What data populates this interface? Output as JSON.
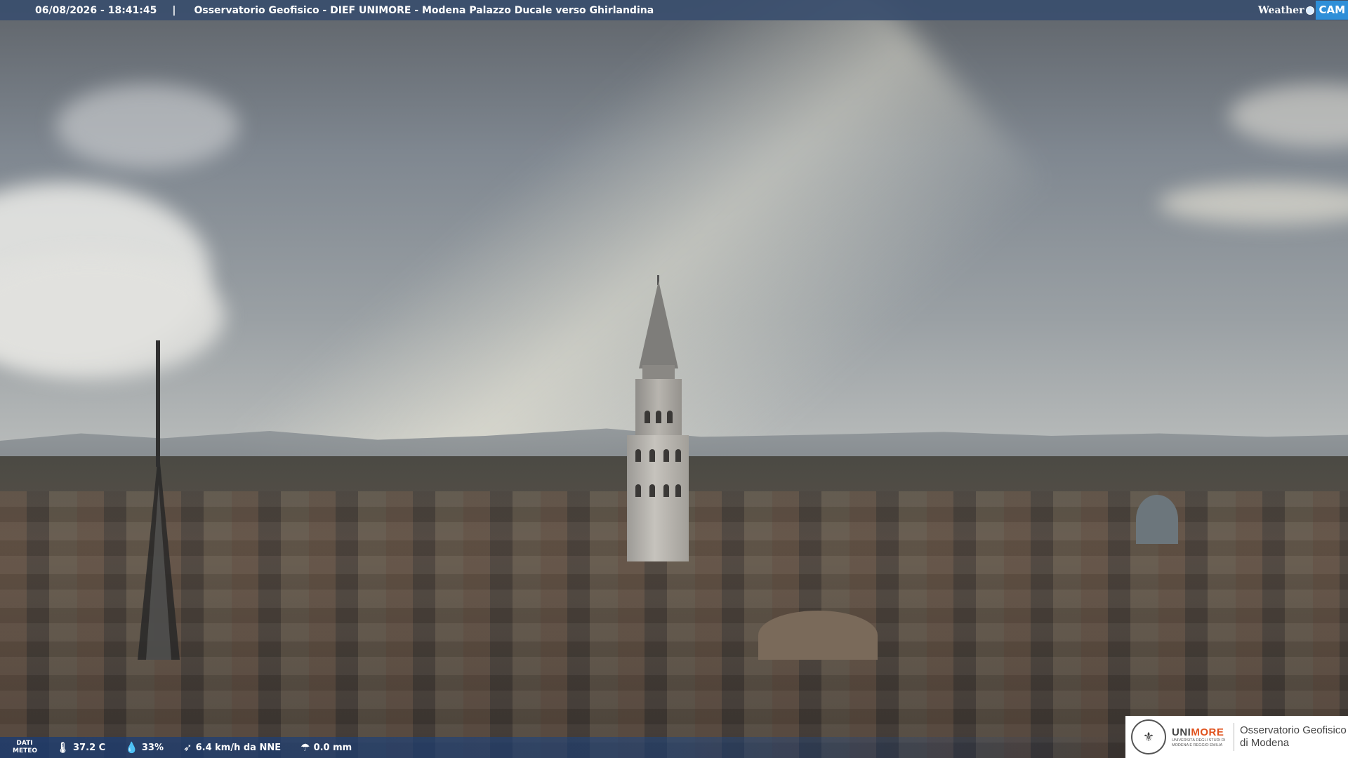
{
  "header": {
    "datetime": "06/08/2026 - 18:41:45",
    "separator": "|",
    "title": "Osservatorio Geofisico - DIEF UNIMORE - Modena Palazzo Ducale verso Ghirlandina"
  },
  "brand": {
    "weather": "Weather",
    "cam": "CAM"
  },
  "weather": {
    "label_line1": "DATI",
    "label_line2": "METEO",
    "temperature": "37.2 C",
    "humidity": "33%",
    "wind": "6.4 km/h da NNE",
    "rain": "0.0 mm",
    "icons": {
      "temperature": "thermometer-icon",
      "humidity": "water-drop-icon",
      "wind": "wind-icon",
      "rain": "rain-icon"
    }
  },
  "logo": {
    "uni_part1": "UNI",
    "uni_part2": "MORE",
    "uni_sub": "UNIVERSITÀ DEGLI STUDI DI MODENA E REGGIO EMILIA",
    "obs_line1": "Osservatorio Geofisico",
    "obs_line2": "di Modena"
  },
  "colors": {
    "topbar": "#3a4e6e",
    "cam_accent": "#2f8fd8",
    "unimore_orange": "#e0521d"
  }
}
